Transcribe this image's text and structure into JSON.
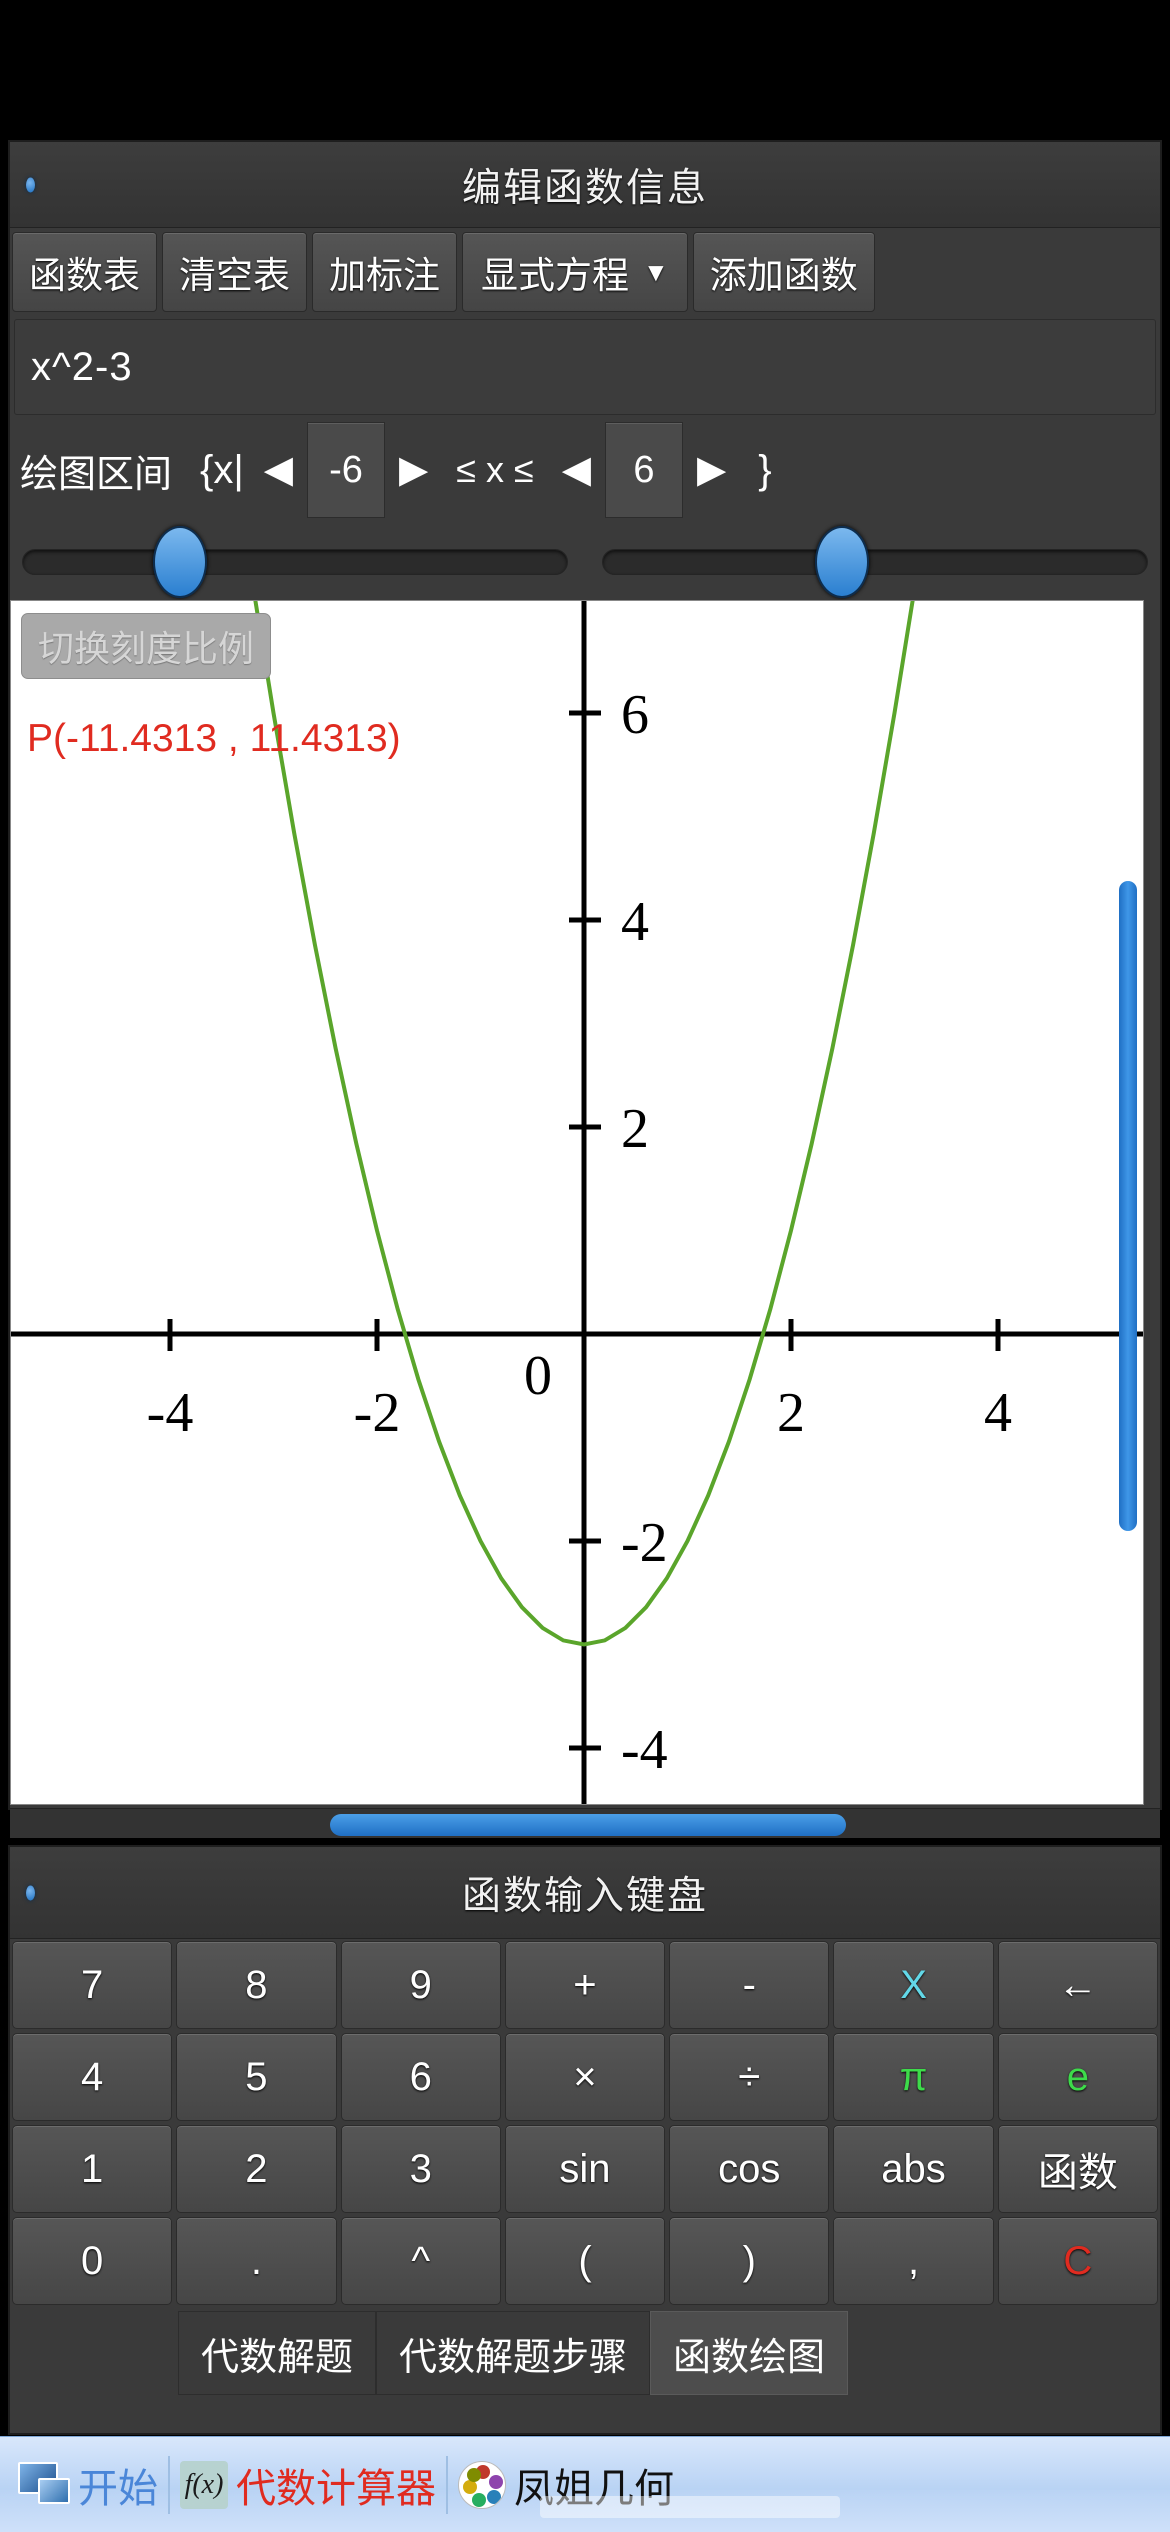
{
  "window": {
    "title": "编辑函数信息",
    "toolbar": [
      {
        "label": "函数表",
        "name": "function-table-button"
      },
      {
        "label": "清空表",
        "name": "clear-table-button"
      },
      {
        "label": "加标注",
        "name": "add-annotation-button"
      },
      {
        "label": "显式方程",
        "name": "equation-type-dropdown",
        "caret": "▼"
      },
      {
        "label": "添加函数",
        "name": "add-function-button"
      }
    ]
  },
  "formula": {
    "value": "x^2-3"
  },
  "range": {
    "label": "绘图区间",
    "brace_open": "{x|",
    "left_arrow": "◀",
    "right_arrow": "▶",
    "min_value": "-6",
    "inequality": "≤ x ≤",
    "max_value": "6",
    "brace_close": "}"
  },
  "graph": {
    "scale_button": "切换刻度比例",
    "point_label": "P(-11.4313 , 11.4313)"
  },
  "chart_data": {
    "type": "line",
    "title": "",
    "expression": "x^2-3",
    "xlabel": "",
    "ylabel": "",
    "xlim": [
      -5.45,
      5.45
    ],
    "ylim": [
      -5.1,
      7.4
    ],
    "domain": [
      -6,
      6
    ],
    "x_ticks": [
      -4,
      -2,
      0,
      2,
      4
    ],
    "x_tick_labels": [
      "-4",
      "-2",
      "0",
      "2",
      "4"
    ],
    "y_ticks": [
      -4,
      -2,
      2,
      4,
      6
    ],
    "y_tick_labels": [
      "-4",
      "-2",
      "2",
      "4",
      "6"
    ],
    "origin_label": "0",
    "grid": false,
    "legend": false,
    "curve_color": "#5aa52b",
    "axis_color": "#000000",
    "series": [
      {
        "name": "x^2-3",
        "x": [
          -3.2,
          -3.0,
          -2.8,
          -2.6,
          -2.4,
          -2.2,
          -2.0,
          -1.8,
          -1.6,
          -1.4,
          -1.2,
          -1.0,
          -0.8,
          -0.6,
          -0.4,
          -0.2,
          0.0,
          0.2,
          0.4,
          0.6,
          0.8,
          1.0,
          1.2,
          1.4,
          1.6,
          1.8,
          2.0,
          2.2,
          2.4,
          2.6,
          2.8,
          3.0,
          3.2
        ],
        "y": [
          7.24,
          6.0,
          4.84,
          3.76,
          2.76,
          1.84,
          1.0,
          0.24,
          -0.44,
          -1.04,
          -1.56,
          -2.0,
          -2.36,
          -2.64,
          -2.84,
          -2.96,
          -3.0,
          -2.96,
          -2.84,
          -2.64,
          -2.36,
          -2.0,
          -1.56,
          -1.04,
          -0.44,
          0.24,
          1.0,
          1.84,
          2.76,
          3.76,
          4.84,
          6.0,
          7.24
        ]
      }
    ]
  },
  "keyboard": {
    "title": "函数输入键盘",
    "rows": [
      [
        {
          "label": "7",
          "style": "plain"
        },
        {
          "label": "8",
          "style": "plain"
        },
        {
          "label": "9",
          "style": "plain"
        },
        {
          "label": "+",
          "style": "plain"
        },
        {
          "label": "-",
          "style": "plain"
        },
        {
          "label": "X",
          "style": "cyan"
        },
        {
          "label": "←",
          "style": "plain"
        }
      ],
      [
        {
          "label": "4",
          "style": "plain"
        },
        {
          "label": "5",
          "style": "plain"
        },
        {
          "label": "6",
          "style": "plain"
        },
        {
          "label": "×",
          "style": "plain"
        },
        {
          "label": "÷",
          "style": "plain"
        },
        {
          "label": "π",
          "style": "green"
        },
        {
          "label": "e",
          "style": "green"
        }
      ],
      [
        {
          "label": "1",
          "style": "plain"
        },
        {
          "label": "2",
          "style": "plain"
        },
        {
          "label": "3",
          "style": "plain"
        },
        {
          "label": "sin",
          "style": "plain"
        },
        {
          "label": "cos",
          "style": "plain"
        },
        {
          "label": "abs",
          "style": "plain"
        },
        {
          "label": "函数",
          "style": "plain"
        }
      ],
      [
        {
          "label": "0",
          "style": "plain"
        },
        {
          "label": ".",
          "style": "plain"
        },
        {
          "label": "^",
          "style": "plain"
        },
        {
          "label": "(",
          "style": "plain"
        },
        {
          "label": ")",
          "style": "plain"
        },
        {
          "label": ",",
          "style": "plain"
        },
        {
          "label": "C",
          "style": "red"
        }
      ]
    ],
    "tabs": [
      {
        "label": "代数解题",
        "active": false
      },
      {
        "label": "代数解题步骤",
        "active": false
      },
      {
        "label": "函数绘图",
        "active": true
      }
    ]
  },
  "taskbar": {
    "start_label": "开始",
    "calc_label": "代数计算器",
    "geo_label": "凤姐几何",
    "fx_icon_text": "f(x)"
  },
  "colors": {
    "accent_blue": "#2a7fd0",
    "curve_green": "#5aa52b",
    "alert_red": "#e02b20",
    "cyan_key": "#62d8e8",
    "green_key": "#3ddb4a"
  }
}
